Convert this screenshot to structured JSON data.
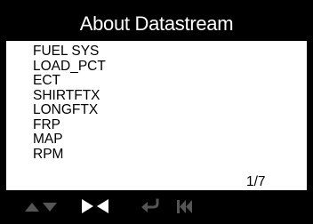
{
  "title": "About Datastream",
  "items": [
    {
      "label": "FUEL SYS"
    },
    {
      "label": "LOAD_PCT"
    },
    {
      "label": "ECT"
    },
    {
      "label": "SHIRTFTX"
    },
    {
      "label": "LONGFTX"
    },
    {
      "label": "FRP"
    },
    {
      "label": "MAP"
    },
    {
      "label": "RPM"
    }
  ],
  "page_indicator": "1/7",
  "toolbar": {
    "buttons": [
      {
        "icon": "up-arrow-icon",
        "enabled": false
      },
      {
        "icon": "down-arrow-icon",
        "enabled": false
      },
      {
        "icon": "right-arrow-icon",
        "enabled": true
      },
      {
        "icon": "left-arrow-icon",
        "enabled": true
      },
      {
        "icon": "return-icon",
        "enabled": false
      },
      {
        "icon": "first-page-icon",
        "enabled": false
      }
    ]
  },
  "colors": {
    "background": "#000000",
    "panel": "#ffffff",
    "text": "#000000",
    "title_text": "#ffffff",
    "icon_enabled": "#ffffff",
    "icon_disabled": "#555555"
  }
}
